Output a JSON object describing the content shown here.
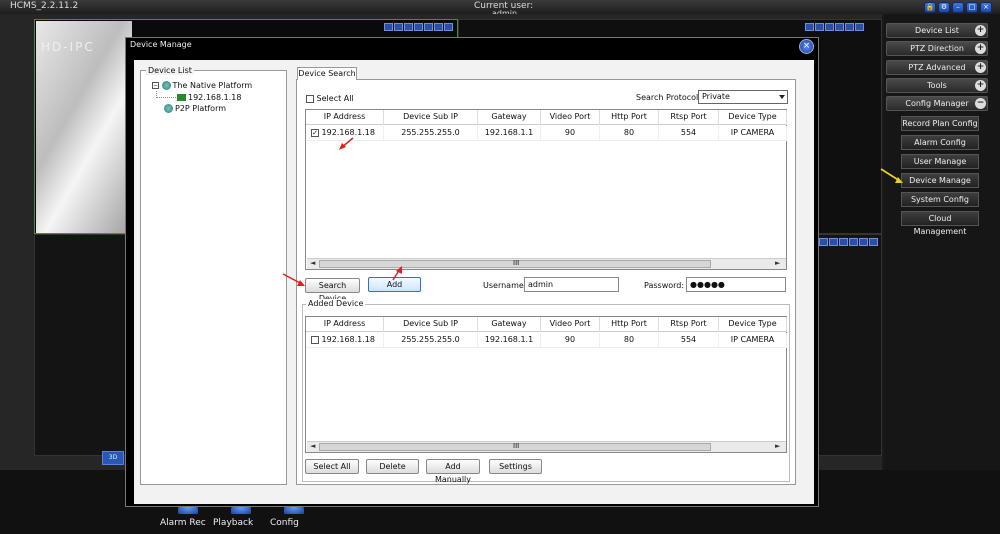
{
  "window": {
    "app_title": "HCMS_2.2.11.2",
    "current_user_label": "Current user:",
    "current_user_value": "admin"
  },
  "video": {
    "label": "HD-IPC"
  },
  "right_panel": {
    "items": [
      {
        "label": "Device List"
      },
      {
        "label": "PTZ Direction"
      },
      {
        "label": "PTZ Advanced"
      },
      {
        "label": "Tools"
      },
      {
        "label": "Config Manager"
      }
    ],
    "sub_items": [
      {
        "label": "Record Plan Config"
      },
      {
        "label": "Alarm Config"
      },
      {
        "label": "User Manage"
      },
      {
        "label": "Device Manage"
      },
      {
        "label": "System Config"
      },
      {
        "label": "Cloud Management"
      }
    ]
  },
  "bottom_bar": {
    "items": [
      {
        "label": "Alarm Rec"
      },
      {
        "label": "Playback"
      },
      {
        "label": "Config"
      }
    ]
  },
  "dialog": {
    "title": "Device Manage",
    "device_list": {
      "caption": "Device List",
      "root1": "The Native Platform",
      "child1": "192.168.1.18",
      "root2": "P2P Platform"
    },
    "tab_label": "Device Search",
    "select_all_label": "Select All",
    "protocol_label": "Search Protocol:",
    "protocol_value": "Private",
    "columns": [
      "IP Address",
      "Device Sub IP",
      "Gateway",
      "Video Port",
      "Http Port",
      "Rtsp Port",
      "Device Type"
    ],
    "search_rows": [
      {
        "checked": "✓",
        "ip": "192.168.1.18",
        "sub": "255.255.255.0",
        "gw": "192.168.1.1",
        "video": "90",
        "http": "80",
        "rtsp": "554",
        "type": "IP CAMERA"
      }
    ],
    "search_device_button": "Search Device",
    "add_button": "Add",
    "username_label": "Username",
    "username_value": "admin",
    "password_label": "Password:",
    "password_value": "●●●●●",
    "added_caption": "Added Device",
    "added_rows": [
      {
        "checked": "",
        "ip": "192.168.1.18",
        "sub": "255.255.255.0",
        "gw": "192.168.1.1",
        "video": "90",
        "http": "80",
        "rtsp": "554",
        "type": "IP CAMERA"
      }
    ],
    "scroll_mid": "III",
    "buttons": {
      "select_all": "Select All",
      "delete": "Delete",
      "add_manually": "Add Manually",
      "settings": "Settings"
    }
  }
}
